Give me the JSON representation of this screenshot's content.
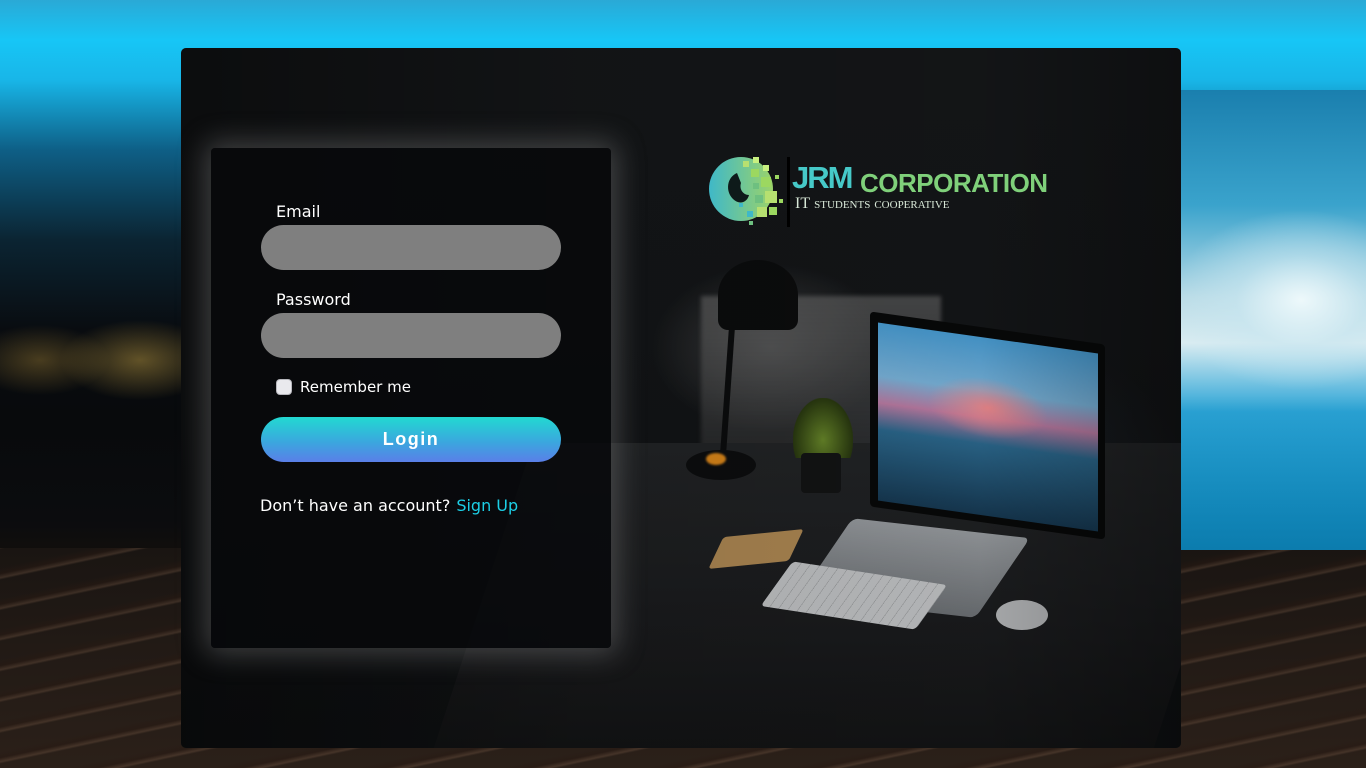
{
  "brand": {
    "name_part1": "JRM",
    "name_part2": "CORPORATION",
    "tagline_it": "IT",
    "tagline_students": "STUDENTS",
    "tagline_coop": "COOPERATIVE"
  },
  "login_form": {
    "email_label": "Email",
    "email_value": "",
    "password_label": "Password",
    "password_value": "",
    "remember_label": "Remember me",
    "remember_checked": false,
    "login_button": "Login",
    "signup_prompt": "Don’t have an account?",
    "signup_link": "Sign Up"
  },
  "colors": {
    "accent_cyan": "#21d9d1",
    "accent_blue": "#5a7fe8",
    "link": "#1ccfe6",
    "input_bg": "#7f7f7f",
    "logo_teal": "#46c9c8",
    "logo_green": "#7fd07a"
  },
  "icons": {
    "logo_mark": "globe-pixel-icon",
    "checkbox": "checkbox-unchecked-icon"
  }
}
